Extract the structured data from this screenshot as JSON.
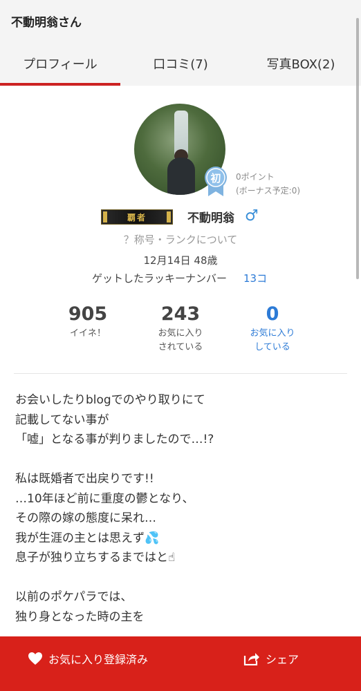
{
  "header": {
    "title": "不動明翁さん"
  },
  "tabs": [
    {
      "label": "プロフィール",
      "active": true
    },
    {
      "label": "口コミ(7)"
    },
    {
      "label": "写真BOX(2)"
    }
  ],
  "profile": {
    "badge": "初",
    "points": "0ポイント",
    "points_bonus": "(ボーナス予定:0)",
    "rank_title": "覇者",
    "name": "不動明翁",
    "gender_symbol": "♂",
    "rank_help": "？称号・ランクについて",
    "birth_age": "12月14日 48歳",
    "lucky_label": "ゲットしたラッキーナンバー",
    "lucky_value": "13コ"
  },
  "stats": [
    {
      "value": "905",
      "label1": "イイネ！",
      "label2": ""
    },
    {
      "value": "243",
      "label1": "お気に入り",
      "label2": "されている"
    },
    {
      "value": "0",
      "label1": "お気に入り",
      "label2": "している"
    }
  ],
  "bio": [
    "お会いしたりblogでのやり取りにて",
    "記載してない事が",
    "「嘘」となる事が判りましたので…!?",
    "",
    "私は既婚者で出戻りです!!",
    "…10年ほど前に重度の鬱となり、",
    "その際の嫁の態度に呆れ…",
    "我が生涯の主とは思えず💦",
    "息子が独り立ちするまではと☝",
    "",
    "以前のポケパラでは、",
    "独り身となった時の主を"
  ],
  "bottom": {
    "favorite_label": "お気に入り登録済み",
    "share_label": "シェア"
  },
  "colors": {
    "accent": "#d8211a",
    "link": "#2d7bd6"
  }
}
